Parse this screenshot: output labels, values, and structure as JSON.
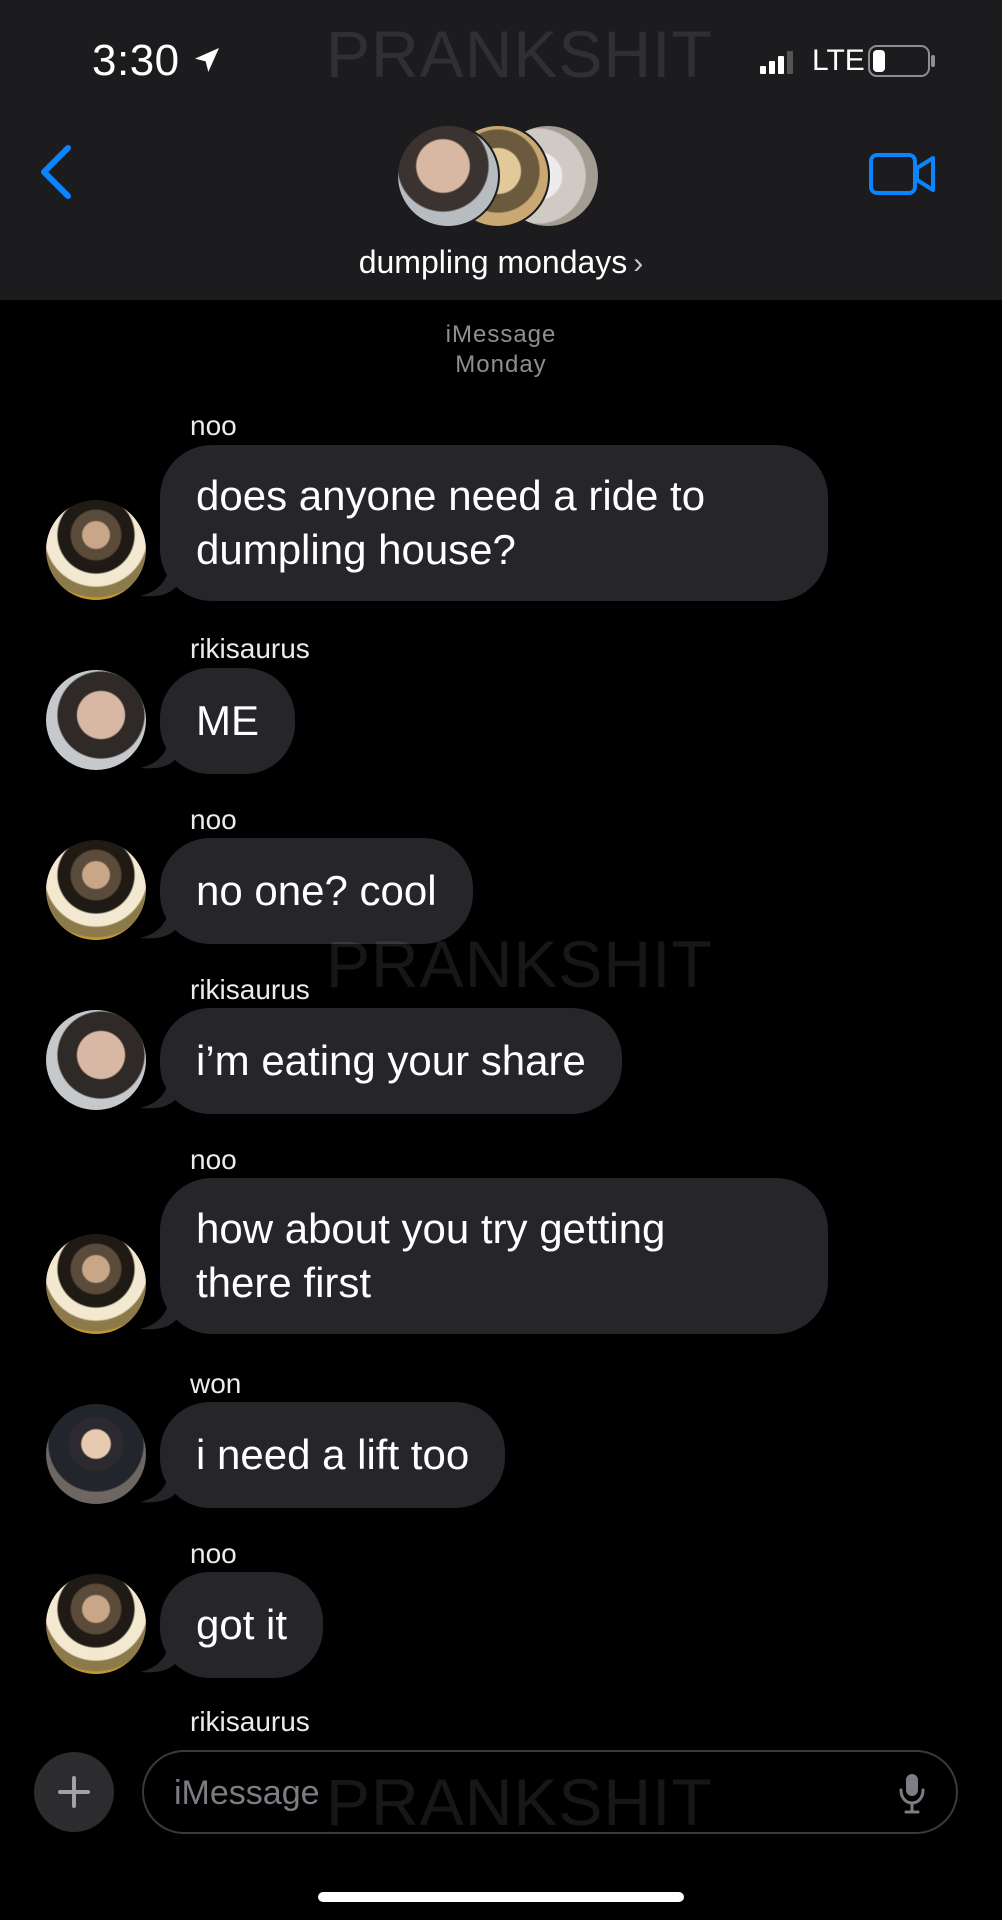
{
  "status_bar": {
    "time": "3:30",
    "network": "LTE"
  },
  "watermark": "PRANKSHIT",
  "header": {
    "group_name": "dumpling mondays",
    "chevron": "›"
  },
  "thread": {
    "service": "iMessage",
    "day": "Monday",
    "messages": [
      {
        "sender": "noo",
        "text_lines": [
          "does anyone need a ride to",
          "dumpling house?"
        ],
        "avatar": "noo"
      },
      {
        "sender": "rikisaurus",
        "text_lines": [
          "ME"
        ],
        "avatar": "riki"
      },
      {
        "sender": "noo",
        "text_lines": [
          "no one? cool"
        ],
        "avatar": "noo"
      },
      {
        "sender": "rikisaurus",
        "text_lines": [
          "i’m eating your share"
        ],
        "avatar": "riki"
      },
      {
        "sender": "noo",
        "text_lines": [
          "how about you try getting",
          "there first"
        ],
        "avatar": "noo"
      },
      {
        "sender": "won",
        "text_lines": [
          "i need a lift too"
        ],
        "avatar": "won"
      },
      {
        "sender": "noo",
        "text_lines": [
          "got it"
        ],
        "avatar": "noo"
      }
    ],
    "next_sender_partial": "rikisaurus"
  },
  "composer": {
    "placeholder": "iMessage"
  },
  "colors": {
    "accent": "#0a84ff",
    "bubble": "#26252a",
    "header_bg": "#1c1c1e"
  }
}
